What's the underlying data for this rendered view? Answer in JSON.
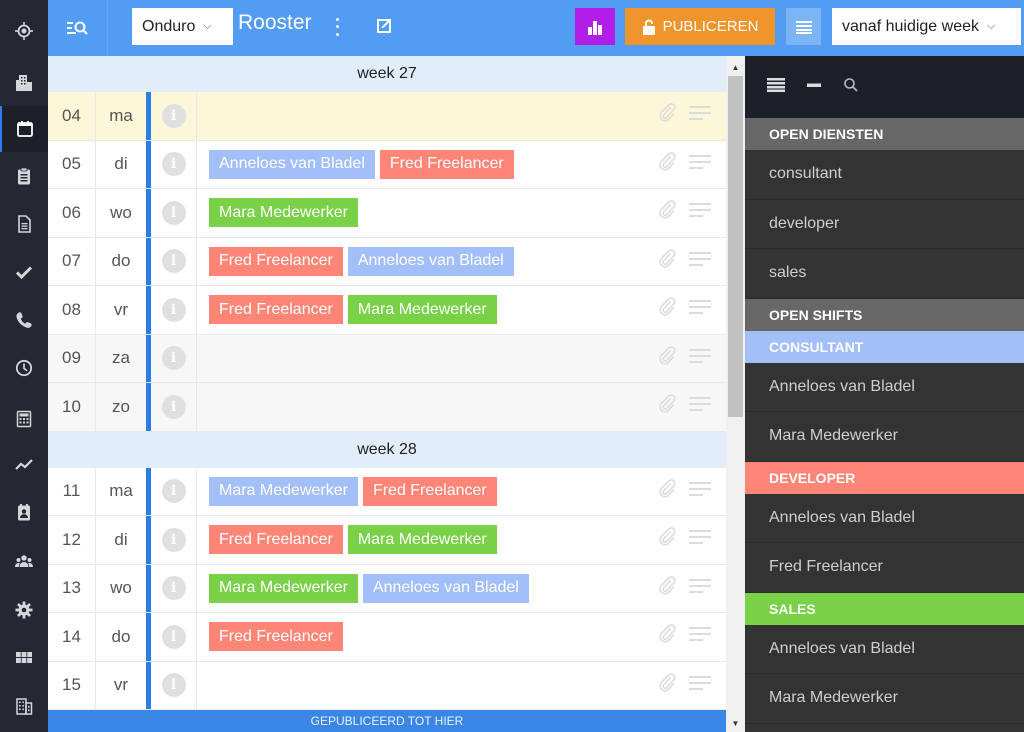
{
  "nav": {
    "items": [
      {
        "name": "locate",
        "label": "Locatie"
      },
      {
        "name": "organisation",
        "label": "Organisatie"
      },
      {
        "name": "calendar",
        "label": "Rooster",
        "active": true
      },
      {
        "name": "clipboard",
        "label": "Taken"
      },
      {
        "name": "document",
        "label": "Documenten"
      },
      {
        "name": "check",
        "label": "Goedkeuren"
      },
      {
        "name": "phone",
        "label": "Contacten"
      },
      {
        "name": "clock",
        "label": "Uren"
      },
      {
        "name": "calculator",
        "label": "Berekenen"
      },
      {
        "name": "chart",
        "label": "Statistieken"
      },
      {
        "name": "badge",
        "label": "Medewerker"
      },
      {
        "name": "team",
        "label": "Team"
      },
      {
        "name": "settings",
        "label": "Instellingen"
      },
      {
        "name": "grid",
        "label": "Overzicht"
      },
      {
        "name": "building",
        "label": "Gebouw"
      }
    ]
  },
  "topbar": {
    "company": "Onduro",
    "title": "Rooster",
    "publish_label": "PUBLICEREN",
    "range": "vanaf huidige week",
    "colors": {
      "bar": "#529cf3",
      "chart": "#b11ee8",
      "publish": "#f0952c"
    }
  },
  "roles": {
    "consultant": {
      "label": "CONSULTANT",
      "color": "#a3bffa"
    },
    "developer": {
      "label": "DEVELOPER",
      "color": "#ff8577"
    },
    "sales": {
      "label": "SALES",
      "color": "#79d147"
    }
  },
  "weeks": [
    {
      "label": "week 27",
      "days": [
        {
          "date": "04",
          "day": "ma",
          "today": true,
          "weekend": false,
          "shifts": []
        },
        {
          "date": "05",
          "day": "di",
          "today": false,
          "weekend": false,
          "shifts": [
            {
              "name": "Anneloes van Bladel",
              "role": "consultant"
            },
            {
              "name": "Fred Freelancer",
              "role": "developer"
            }
          ]
        },
        {
          "date": "06",
          "day": "wo",
          "today": false,
          "weekend": false,
          "shifts": [
            {
              "name": "Mara Medewerker",
              "role": "sales"
            }
          ]
        },
        {
          "date": "07",
          "day": "do",
          "today": false,
          "weekend": false,
          "shifts": [
            {
              "name": "Fred Freelancer",
              "role": "developer"
            },
            {
              "name": "Anneloes van Bladel",
              "role": "consultant"
            }
          ]
        },
        {
          "date": "08",
          "day": "vr",
          "today": false,
          "weekend": false,
          "shifts": [
            {
              "name": "Fred Freelancer",
              "role": "developer"
            },
            {
              "name": "Mara Medewerker",
              "role": "sales"
            }
          ]
        },
        {
          "date": "09",
          "day": "za",
          "today": false,
          "weekend": true,
          "shifts": []
        },
        {
          "date": "10",
          "day": "zo",
          "today": false,
          "weekend": true,
          "shifts": []
        }
      ]
    },
    {
      "label": "week 28",
      "days": [
        {
          "date": "11",
          "day": "ma",
          "today": false,
          "weekend": false,
          "shifts": [
            {
              "name": "Mara Medewerker",
              "role": "consultant"
            },
            {
              "name": "Fred Freelancer",
              "role": "developer"
            }
          ]
        },
        {
          "date": "12",
          "day": "di",
          "today": false,
          "weekend": false,
          "shifts": [
            {
              "name": "Fred Freelancer",
              "role": "developer"
            },
            {
              "name": "Mara Medewerker",
              "role": "sales"
            }
          ]
        },
        {
          "date": "13",
          "day": "wo",
          "today": false,
          "weekend": false,
          "shifts": [
            {
              "name": "Mara Medewerker",
              "role": "sales"
            },
            {
              "name": "Anneloes van Bladel",
              "role": "consultant"
            }
          ]
        },
        {
          "date": "14",
          "day": "do",
          "today": false,
          "weekend": false,
          "shifts": [
            {
              "name": "Fred Freelancer",
              "role": "developer"
            }
          ]
        },
        {
          "date": "15",
          "day": "vr",
          "today": false,
          "weekend": false,
          "shifts": []
        }
      ]
    }
  ],
  "published_marker": "GEPUBLICEERD TOT HIER",
  "panel": {
    "open_services_title": "OPEN DIENSTEN",
    "open_services": [
      "consultant",
      "developer",
      "sales"
    ],
    "open_shifts_title": "OPEN SHIFTS",
    "open_shifts": [
      {
        "role": "consultant",
        "people": [
          "Anneloes van Bladel",
          "Mara Medewerker"
        ]
      },
      {
        "role": "developer",
        "people": [
          "Anneloes van Bladel",
          "Fred Freelancer"
        ]
      },
      {
        "role": "sales",
        "people": [
          "Anneloes van Bladel",
          "Mara Medewerker"
        ]
      }
    ]
  }
}
